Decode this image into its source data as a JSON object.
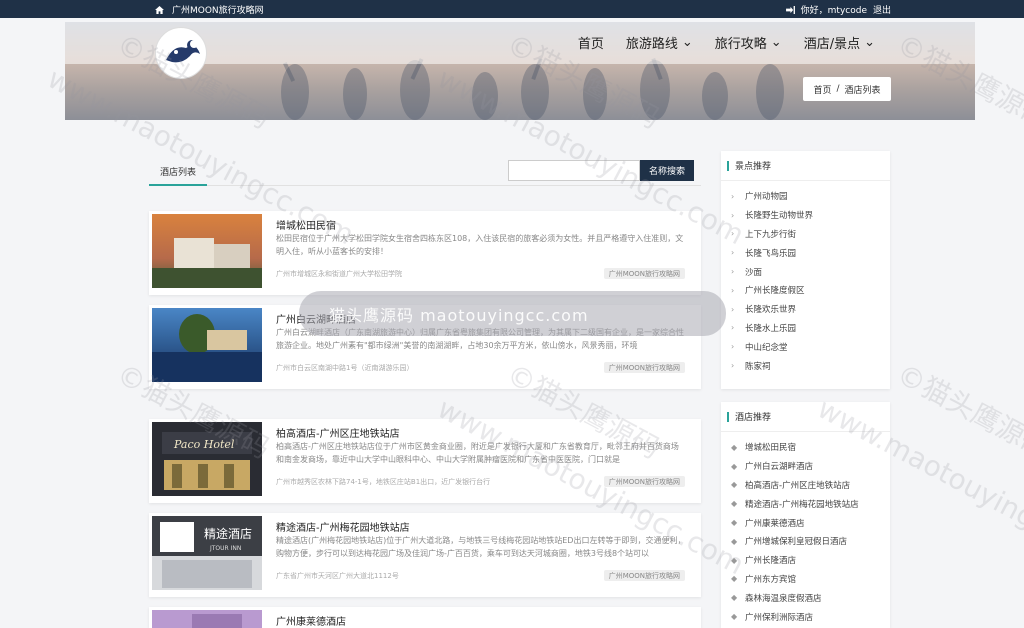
{
  "topbar": {
    "site_name": "广州MOON旅行攻略网",
    "greeting": "你好，",
    "username": "mtycode",
    "logout": "退出"
  },
  "nav": [
    {
      "label": "首页",
      "dropdown": false
    },
    {
      "label": "旅游路线",
      "dropdown": true
    },
    {
      "label": "旅行攻略",
      "dropdown": true
    },
    {
      "label": "酒店/景点",
      "dropdown": true
    }
  ],
  "breadcrumb": {
    "home": "首页",
    "sep": "/",
    "current": "酒店列表"
  },
  "main": {
    "tab": "酒店列表",
    "search_value": "",
    "search_btn": "名称搜索"
  },
  "hotels": [
    {
      "title": "增城松田民宿",
      "desc": "松田民宿位于广州大学松田学院女生宿舍四栋东区108，入住该民宿的旅客必须为女性。并且严格遵守入住准则，文明入住，听从小蓝客长的安排！",
      "addr": "广州市增城区永和街道广州大学松田学院",
      "tag": "广州MOON旅行攻略网"
    },
    {
      "title": "广州白云湖畔酒店",
      "desc": "广州白云湖畔酒店（广东南湖旅游中心）归属广东省粤旅集团有限公司管理，为其属下二级国有企业，是一家综合性旅游企业。地处广州素有\"都市绿洲\"美誉的南湖湖畔，占地30余万平方米，依山傍水，风景秀丽，环境",
      "addr": "广州市白云区南湖中路1号（近南湖游乐园）",
      "tag": "广州MOON旅行攻略网"
    },
    {
      "title": "柏高酒店-广州区庄地铁站店",
      "desc": "柏高酒店-广州区庄地铁站店位于广州市区黄金商业圈，附近是广发银行大厦和广东省教育厅，毗邻王府井百货商场和南金发商场，靠近中山大学中山眼科中心、中山大学附属肿瘤医院和广东省中医医院，门口就是",
      "addr": "广州市越秀区农林下路74-1号，地铁区庄站B1出口，近广发银行台行",
      "tag": "广州MOON旅行攻略网"
    },
    {
      "title": "精途酒店-广州梅花园地铁站店",
      "desc": "精途酒店(广州梅花园地铁站店)位于广州大道北路，与地铁三号线梅花园站地铁站ED出口左转等于即到，交通便利，购物方便，步行可以到达梅花园广场及佳润广场-广百百货，乘车可到达天河城商圈，地铁3号线8个站可以",
      "addr": "广东省广州市天河区广州大道北1112号",
      "tag": "广州MOON旅行攻略网"
    },
    {
      "title": "广州康莱德酒店",
      "desc": "",
      "addr": "",
      "tag": ""
    }
  ],
  "overlay_text": "猫头鹰源码 maotouyingcc.com",
  "watermarks": [
    "©猫头鹰源码",
    "www.maotouyingcc.com"
  ],
  "sidebar": {
    "scenic": {
      "title": "景点推荐",
      "items": [
        "广州动物园",
        "长隆野生动物世界",
        "上下九步行街",
        "长隆飞鸟乐园",
        "沙面",
        "广州长隆度假区",
        "长隆欢乐世界",
        "长隆水上乐园",
        "中山纪念堂",
        "陈家祠"
      ]
    },
    "hotels": {
      "title": "酒店推荐",
      "items": [
        "增城松田民宿",
        "广州白云湖畔酒店",
        "柏高酒店-广州区庄地铁站店",
        "精途酒店-广州梅花园地铁站店",
        "广州康莱德酒店",
        "广州增城保利皇冠假日酒店",
        "广州长隆酒店",
        "广州东方宾馆",
        "森林海温泉度假酒店",
        "广州保利洲际酒店"
      ]
    }
  },
  "colors": {
    "topbar": "#1f3147",
    "accent": "#2aa39a",
    "button": "#1f3147"
  }
}
